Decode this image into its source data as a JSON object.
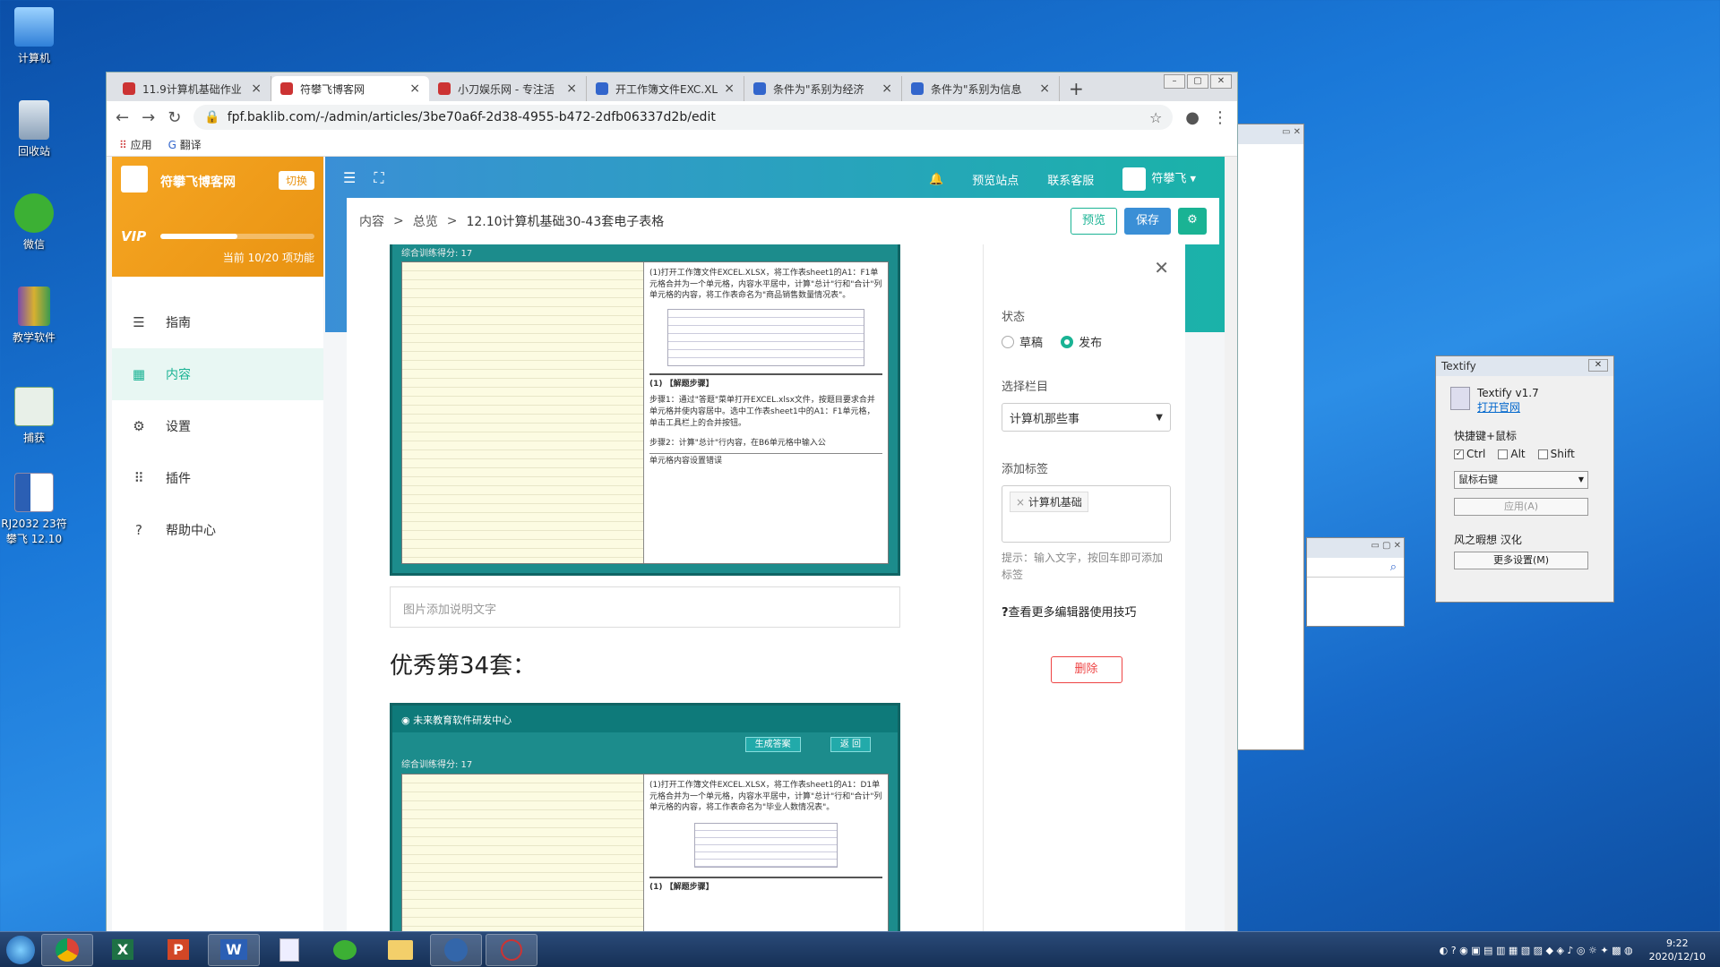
{
  "desktop": {
    "icons": [
      {
        "label": "计算机"
      },
      {
        "label": "回收站"
      },
      {
        "label": "微信"
      },
      {
        "label": "教学软件"
      },
      {
        "label": "捕获"
      },
      {
        "label": "RJ2032 23符攀飞 12.10"
      }
    ]
  },
  "browser": {
    "tabs": [
      {
        "title": "11.9计算机基础作业"
      },
      {
        "title": "符攀飞博客网"
      },
      {
        "title": "小刀娱乐网 - 专注活"
      },
      {
        "title": "开工作簿文件EXC.XL"
      },
      {
        "title": "条件为\"系别为经济"
      },
      {
        "title": "条件为\"系别为信息"
      }
    ],
    "new_tab": "+",
    "url": "fpf.baklib.com/-/admin/articles/3be70a6f-2d38-4955-b472-2dfb06337d2b/edit",
    "bookmarks": {
      "apps": "应用",
      "translate": "翻译"
    }
  },
  "sidebar": {
    "site_name": "符攀飞博客网",
    "switch_label": "切换",
    "vip": "VIP",
    "quota_text": "当前 10/20 项功能",
    "quota_fraction": 0.5,
    "items": [
      {
        "label": "指南"
      },
      {
        "label": "内容"
      },
      {
        "label": "设置"
      },
      {
        "label": "插件"
      },
      {
        "label": "帮助中心"
      }
    ]
  },
  "header": {
    "preview_site": "预览站点",
    "contact": "联系客服",
    "user": "符攀飞"
  },
  "breadcrumb": {
    "items": [
      "内容",
      "总览",
      "12.10计算机基础30-43套电子表格"
    ],
    "sep": ">",
    "preview_btn": "预览",
    "save_btn": "保存"
  },
  "editor": {
    "shot1": {
      "score": "综合训练得分:  17",
      "text": "(1)打开工作簿文件EXCEL.XLSX，将工作表sheet1的A1：F1单元格合并为一个单元格，内容水平居中，计算\"总计\"行和\"合计\"列单元格的内容，将工作表命名为\"商品销售数量情况表\"。",
      "steps_title": "(1) 【解题步骤】",
      "step1": "步骤1：通过\"答题\"菜单打开EXCEL.xlsx文件，按题目要求合并单元格并使内容居中。选中工作表sheet1中的A1：F1单元格，单击工具栏上的合并按钮。",
      "step2": "步骤2：计算\"总计\"行内容，在B6单元格中输入公",
      "error": "单元格内容设置错误"
    },
    "caption_placeholder": "图片添加说明文字",
    "heading": "优秀第34套：",
    "shot2": {
      "header": "未来教育软件研发中心",
      "btn_answer": "生成答案",
      "btn_back": "返 回",
      "score": "综合训练得分:  17",
      "text": "(1)打开工作簿文件EXCEL.XLSX，将工作表sheet1的A1：D1单元格合并为一个单元格，内容水平居中，计算\"总计\"行和\"合计\"列单元格的内容，将工作表命名为\"毕业人数情况表\"。",
      "steps_title": "(1) 【解题步骤】"
    }
  },
  "panel": {
    "status_label": "状态",
    "draft": "草稿",
    "publish": "发布",
    "column_label": "选择栏目",
    "column_value": "计算机那些事",
    "tags_label": "添加标签",
    "tag": "计算机基础",
    "hint": "提示：输入文字，按回车即可添加标签",
    "tips": "查看更多编辑器使用技巧",
    "delete": "删除"
  },
  "textify": {
    "title": "Textify",
    "version": "Textify v1.7",
    "site_link": "打开官网",
    "hotkey_label": "快捷键+鼠标",
    "ctrl": "Ctrl",
    "alt": "Alt",
    "shift": "Shift",
    "mouse_value": "鼠标右键",
    "apply": "应用(A)",
    "credit": "风之暇想 汉化",
    "more": "更多设置(M)"
  },
  "taskbar": {
    "time": "9:22",
    "date": "2020/12/10"
  }
}
